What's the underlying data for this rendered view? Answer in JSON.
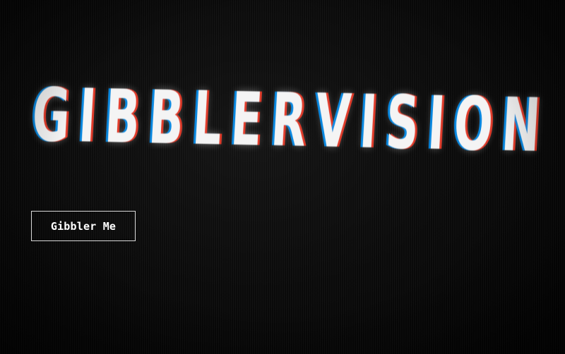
{
  "logo": {
    "text": "GIBBLERVISION"
  },
  "actions": {
    "primary_label": "Gibbler Me"
  },
  "colors": {
    "background": "#050505",
    "logo_text": "#f4f4f4",
    "chroma_left": "#0096ff",
    "chroma_right": "#ff3c28",
    "button_border": "#d8d8d8",
    "button_text": "#ffffff"
  }
}
